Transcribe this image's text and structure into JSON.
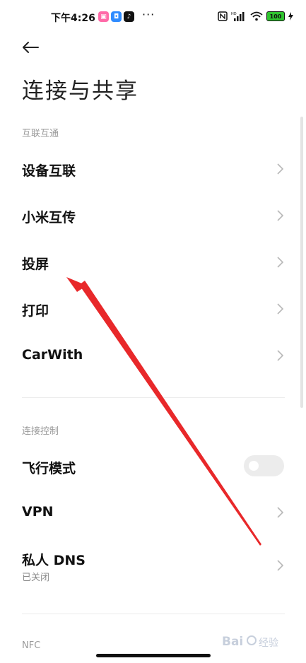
{
  "status_bar": {
    "time": "下午4:26",
    "more": "···",
    "battery_level": "100",
    "apps": [
      {
        "icon": "app-icon-pink",
        "color": "#ff6aa8"
      },
      {
        "icon": "app-icon-blue",
        "color": "#2f8cff"
      },
      {
        "icon": "tiktok-icon",
        "color": "#111111"
      }
    ]
  },
  "header": {
    "title": "连接与共享"
  },
  "sections": [
    {
      "header": "互联互通",
      "items": [
        {
          "label": "设备互联"
        },
        {
          "label": "小米互传"
        },
        {
          "label": "投屏"
        },
        {
          "label": "打印"
        },
        {
          "label": "CarWith"
        }
      ]
    },
    {
      "header": "连接控制",
      "items": [
        {
          "label": "飞行模式",
          "toggle": false
        },
        {
          "label": "VPN"
        },
        {
          "label": "私人 DNS",
          "sub": "已关闭"
        }
      ]
    },
    {
      "header": "NFC"
    }
  ],
  "annotation": {
    "color": "#e8282a"
  },
  "watermark": {
    "text": "Bai 经验"
  }
}
